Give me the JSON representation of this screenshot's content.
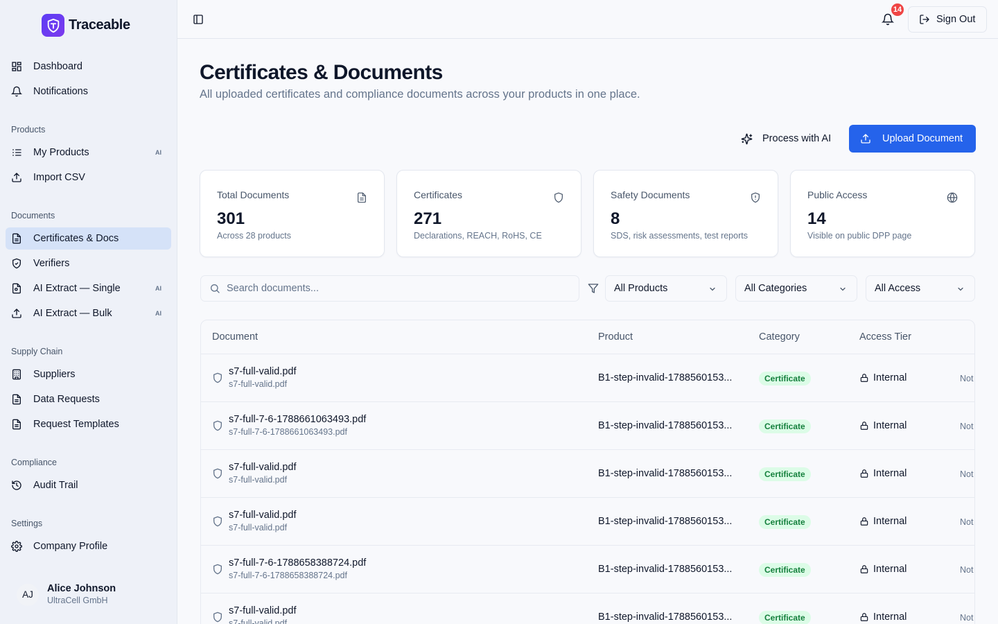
{
  "brand": {
    "name": "Traceable"
  },
  "sidebar": {
    "top_items": [
      {
        "label": "Dashboard"
      },
      {
        "label": "Notifications"
      }
    ],
    "sections": {
      "products": {
        "label": "Products",
        "items": [
          {
            "label": "My Products",
            "badge": "AI"
          },
          {
            "label": "Import CSV"
          }
        ]
      },
      "documents": {
        "label": "Documents",
        "items": [
          {
            "label": "Certificates & Docs"
          },
          {
            "label": "Verifiers"
          },
          {
            "label": "AI Extract — Single",
            "badge": "AI"
          },
          {
            "label": "AI Extract — Bulk",
            "badge": "AI"
          }
        ]
      },
      "supply_chain": {
        "label": "Supply Chain",
        "items": [
          {
            "label": "Suppliers"
          },
          {
            "label": "Data Requests"
          },
          {
            "label": "Request Templates"
          }
        ]
      },
      "compliance": {
        "label": "Compliance",
        "items": [
          {
            "label": "Audit Trail"
          }
        ]
      },
      "settings": {
        "label": "Settings",
        "items": [
          {
            "label": "Company Profile"
          }
        ]
      }
    },
    "active_item": "Certificates & Docs",
    "user": {
      "initials": "AJ",
      "name": "Alice Johnson",
      "org": "UltraCell GmbH"
    }
  },
  "topbar": {
    "notification_count": "14",
    "sign_out_label": "Sign Out"
  },
  "page": {
    "title": "Certificates & Documents",
    "subtitle": "All uploaded certificates and compliance documents across your products in one place."
  },
  "actions": {
    "process_ai_label": "Process with AI",
    "upload_label": "Upload Document"
  },
  "stats": [
    {
      "label": "Total Documents",
      "value": "301",
      "caption": "Across 28 products",
      "icon": "file-icon"
    },
    {
      "label": "Certificates",
      "value": "271",
      "caption": "Declarations, REACH, RoHS, CE",
      "icon": "shield-icon"
    },
    {
      "label": "Safety Documents",
      "value": "8",
      "caption": "SDS, risk assessments, test reports",
      "icon": "shield-alert-icon"
    },
    {
      "label": "Public Access",
      "value": "14",
      "caption": "Visible on public DPP page",
      "icon": "globe-icon"
    }
  ],
  "filters": {
    "search_placeholder": "Search documents...",
    "product": "All Products",
    "category": "All Categories",
    "access": "All Access"
  },
  "table": {
    "columns": [
      "Document",
      "Product",
      "Category",
      "Access Tier"
    ],
    "rows": [
      {
        "name": "s7-full-valid.pdf",
        "file": "s7-full-valid.pdf",
        "product": "B1-step-invalid-1788560153...",
        "category": "Certificate",
        "access": "Internal",
        "extra": "Not"
      },
      {
        "name": "s7-full-7-6-1788661063493.pdf",
        "file": "s7-full-7-6-1788661063493.pdf",
        "product": "B1-step-invalid-1788560153...",
        "category": "Certificate",
        "access": "Internal",
        "extra": "Not"
      },
      {
        "name": "s7-full-valid.pdf",
        "file": "s7-full-valid.pdf",
        "product": "B1-step-invalid-1788560153...",
        "category": "Certificate",
        "access": "Internal",
        "extra": "Not"
      },
      {
        "name": "s7-full-valid.pdf",
        "file": "s7-full-valid.pdf",
        "product": "B1-step-invalid-1788560153...",
        "category": "Certificate",
        "access": "Internal",
        "extra": "Not"
      },
      {
        "name": "s7-full-7-6-1788658388724.pdf",
        "file": "s7-full-7-6-1788658388724.pdf",
        "product": "B1-step-invalid-1788560153...",
        "category": "Certificate",
        "access": "Internal",
        "extra": "Not"
      },
      {
        "name": "s7-full-valid.pdf",
        "file": "s7-full-valid.pdf",
        "product": "B1-step-invalid-1788560153...",
        "category": "Certificate",
        "access": "Internal",
        "extra": "Not"
      }
    ]
  },
  "colors": {
    "primary": "#2563eb",
    "brand": "#6d3af0",
    "active_nav": "#d5e2f8",
    "badge_red": "#ef4444",
    "certificate_bg": "#dcfce7",
    "certificate_text": "#15803d"
  }
}
